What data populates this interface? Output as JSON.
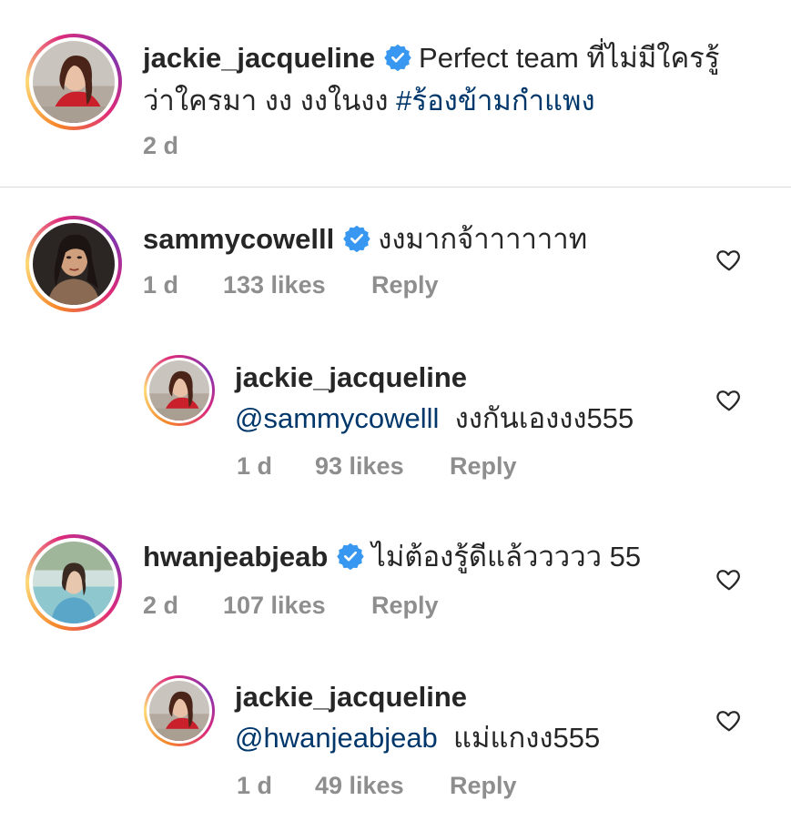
{
  "caption": {
    "username": "jackie_jacqueline",
    "text_part1": "Perfect team ",
    "text_part2": "ที่ไม่มีใครรู้ว่าใครมา งง  งงในงง ",
    "hashtag": "#ร้องข้ามกำแพง",
    "time": "2 d"
  },
  "comments": [
    {
      "username": "sammycowelll",
      "verified": true,
      "text": "งงมากจ้าาาาาาท",
      "time": "1 d",
      "likes": "133 likes",
      "reply_label": "Reply"
    },
    {
      "username": "jackie_jacqueline",
      "mention": "@sammycowelll",
      "text": "งงกันเองงง555",
      "time": "1 d",
      "likes": "93 likes",
      "reply_label": "Reply"
    },
    {
      "username": "hwanjeabjeab",
      "verified": true,
      "text": "ไม่ต้องรู้ดีแล้ววววว 55",
      "time": "2 d",
      "likes": "107 likes",
      "reply_label": "Reply"
    },
    {
      "username": "jackie_jacqueline",
      "mention": "@hwanjeabjeab",
      "text": "แม่แกงง555",
      "time": "1 d",
      "likes": "49 likes",
      "reply_label": "Reply"
    }
  ],
  "colors": {
    "link": "#00376b",
    "verified": "#3897f0",
    "meta": "#8e8e8e"
  }
}
